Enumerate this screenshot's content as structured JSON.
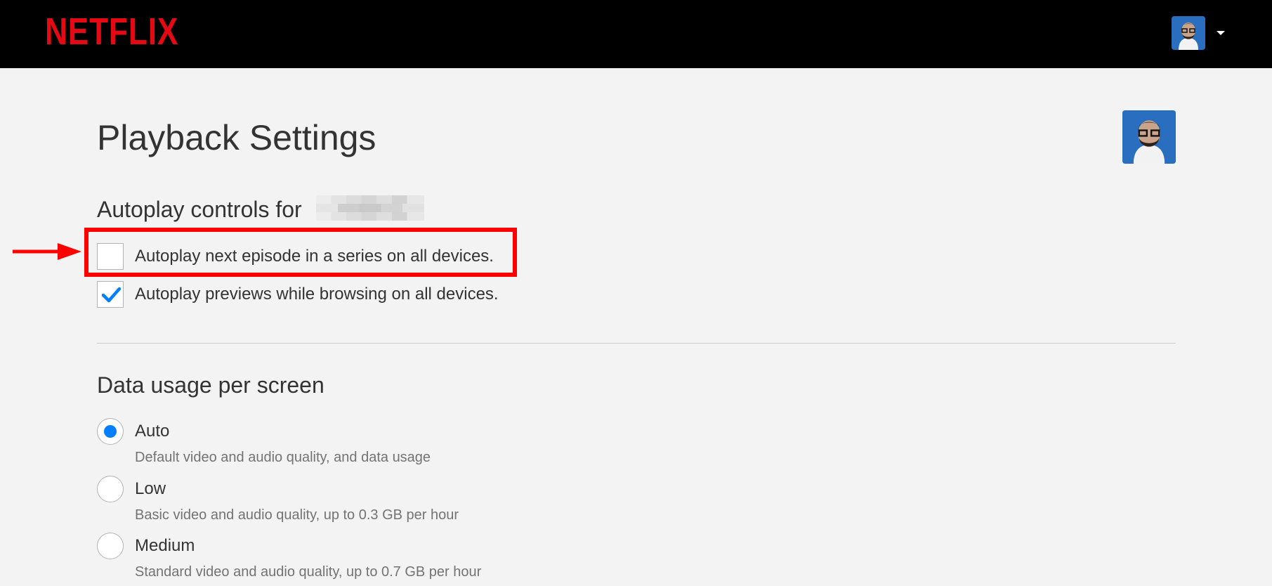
{
  "header": {
    "logo": "NETFLIX",
    "brand_color": "#e50914",
    "profile_menu_icon": "caret-down-icon"
  },
  "page": {
    "title": "Playback Settings"
  },
  "autoplay": {
    "heading": "Autoplay controls for",
    "options": [
      {
        "label": "Autoplay next episode in a series on all devices.",
        "checked": false
      },
      {
        "label": "Autoplay previews while browsing on all devices.",
        "checked": true
      }
    ]
  },
  "data_usage": {
    "heading": "Data usage per screen",
    "options": [
      {
        "label": "Auto",
        "description": "Default video and audio quality, and data usage",
        "selected": true
      },
      {
        "label": "Low",
        "description": "Basic video and audio quality, up to 0.3 GB per hour",
        "selected": false
      },
      {
        "label": "Medium",
        "description": "Standard video and audio quality, up to 0.7 GB per hour",
        "selected": false
      }
    ]
  },
  "colors": {
    "accent": "#0080ff",
    "highlight": "#ff0000"
  }
}
